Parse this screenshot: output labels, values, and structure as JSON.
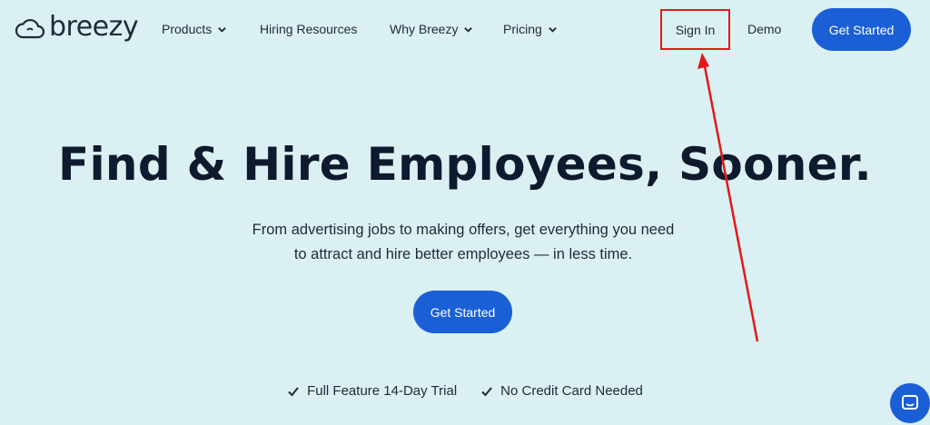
{
  "header": {
    "logo_text": "breezy",
    "nav": {
      "products": "Products",
      "hiring_resources": "Hiring Resources",
      "why_breezy": "Why Breezy",
      "pricing": "Pricing"
    },
    "sign_in": "Sign In",
    "demo": "Demo",
    "get_started": "Get Started"
  },
  "hero": {
    "title": "Find & Hire Employees, Sooner.",
    "subtitle_line1": "From advertising jobs to making offers, get everything you need",
    "subtitle_line2": "to attract and hire better employees — in less time.",
    "cta": "Get Started"
  },
  "perks": [
    {
      "label": "Full Feature 14-Day Trial",
      "icon": "check-icon"
    },
    {
      "label": "No Credit Card Needed",
      "icon": "check-icon"
    }
  ],
  "annotation": {
    "highlight_color": "#e41818"
  },
  "colors": {
    "background": "#dbf0f2",
    "accent": "#1a5fd6",
    "text": "#0f1a2e"
  }
}
